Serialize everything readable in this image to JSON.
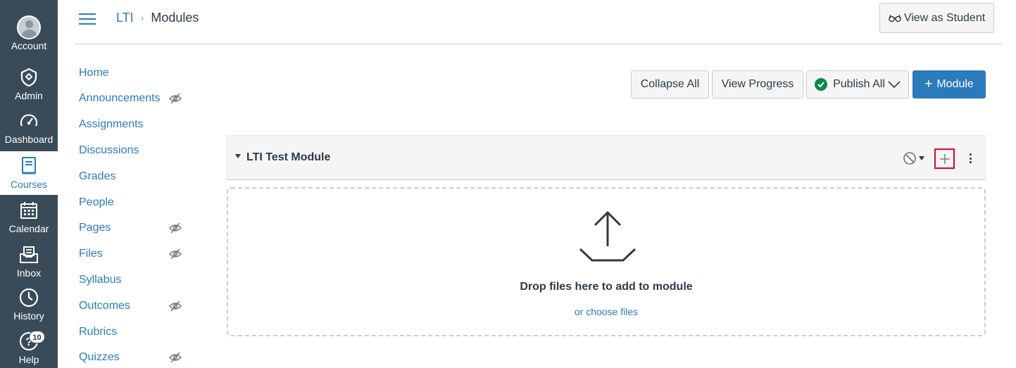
{
  "global_nav": {
    "items": [
      {
        "label": "Account",
        "icon": "avatar"
      },
      {
        "label": "Admin",
        "icon": "shield-icon"
      },
      {
        "label": "Dashboard",
        "icon": "speedometer-icon"
      },
      {
        "label": "Courses",
        "icon": "book-icon",
        "active": true
      },
      {
        "label": "Calendar",
        "icon": "calendar-icon"
      },
      {
        "label": "Inbox",
        "icon": "inbox-icon"
      },
      {
        "label": "History",
        "icon": "clock-icon"
      },
      {
        "label": "Help",
        "icon": "question-icon",
        "badge": "10"
      }
    ]
  },
  "header": {
    "breadcrumb_course": "LTI",
    "breadcrumb_separator": "›",
    "breadcrumb_current": "Modules",
    "view_as_student": "View as Student"
  },
  "course_nav": {
    "items": [
      {
        "label": "Home",
        "hidden": false
      },
      {
        "label": "Announcements",
        "hidden": true
      },
      {
        "label": "Assignments",
        "hidden": false
      },
      {
        "label": "Discussions",
        "hidden": false
      },
      {
        "label": "Grades",
        "hidden": false
      },
      {
        "label": "People",
        "hidden": false
      },
      {
        "label": "Pages",
        "hidden": true
      },
      {
        "label": "Files",
        "hidden": true
      },
      {
        "label": "Syllabus",
        "hidden": false
      },
      {
        "label": "Outcomes",
        "hidden": true
      },
      {
        "label": "Rubrics",
        "hidden": false
      },
      {
        "label": "Quizzes",
        "hidden": true
      }
    ]
  },
  "toolbar": {
    "collapse_all": "Collapse All",
    "view_progress": "View Progress",
    "publish_all": "Publish All",
    "add_module": "Module",
    "add_module_prefix": "+"
  },
  "module": {
    "title": "LTI Test Module",
    "drop_text": "Drop files here to add to module",
    "choose_files": "or choose files"
  },
  "colors": {
    "brand": "#2b7abc",
    "nav_bg": "#394b58",
    "success": "#0b874b",
    "highlight": "#e0061f"
  }
}
